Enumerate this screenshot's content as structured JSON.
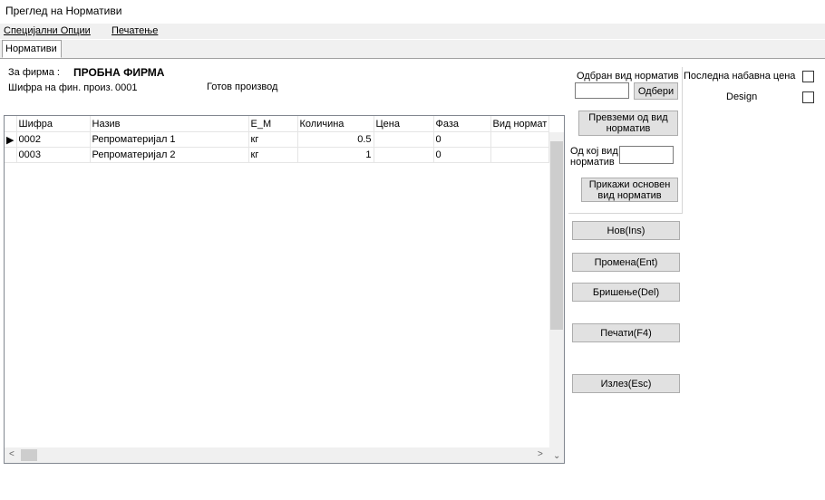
{
  "window": {
    "title": "Преглед на Нормативи"
  },
  "menu": {
    "items": [
      "Специјални Опции",
      "Печатење"
    ]
  },
  "tabs": {
    "active": "Нормативи"
  },
  "header": {
    "firm_label": "За фирма :",
    "firm_name": "ПРОБНА ФИРМА",
    "product_label": "Шифра на фин. произ.",
    "product_code": "0001",
    "product_name": "Готов производ"
  },
  "grid": {
    "columns": [
      "Шифра",
      "Назив",
      "Е_М",
      "Количина",
      "Цена",
      "Фаза",
      "Вид нормат"
    ],
    "rows": [
      {
        "code": "0002",
        "name": "Репроматеријал 1",
        "unit": "кг",
        "qty": "0.5",
        "price": "",
        "phase": "0",
        "norm": ""
      },
      {
        "code": "0003",
        "name": "Репроматеријал 2",
        "unit": "кг",
        "qty": "1",
        "price": "",
        "phase": "0",
        "norm": ""
      }
    ]
  },
  "side": {
    "selected_norm_label": "Одбран вид норматив",
    "select_button": "Одбери",
    "take_norm_button": "Превземи од  вид норматив",
    "from_norm_label": "Од кој вид норматив",
    "show_base_button": "Прикажи основен вид норматив",
    "new_button": "Нов(Ins)",
    "edit_button": "Промена(Ent)",
    "delete_button": "Бришење(Del)",
    "print_button": "Печати(F4)",
    "exit_button": "Излез(Esc)"
  },
  "options": {
    "last_price_label": "Последна набавна цена",
    "design_label": "Design"
  }
}
